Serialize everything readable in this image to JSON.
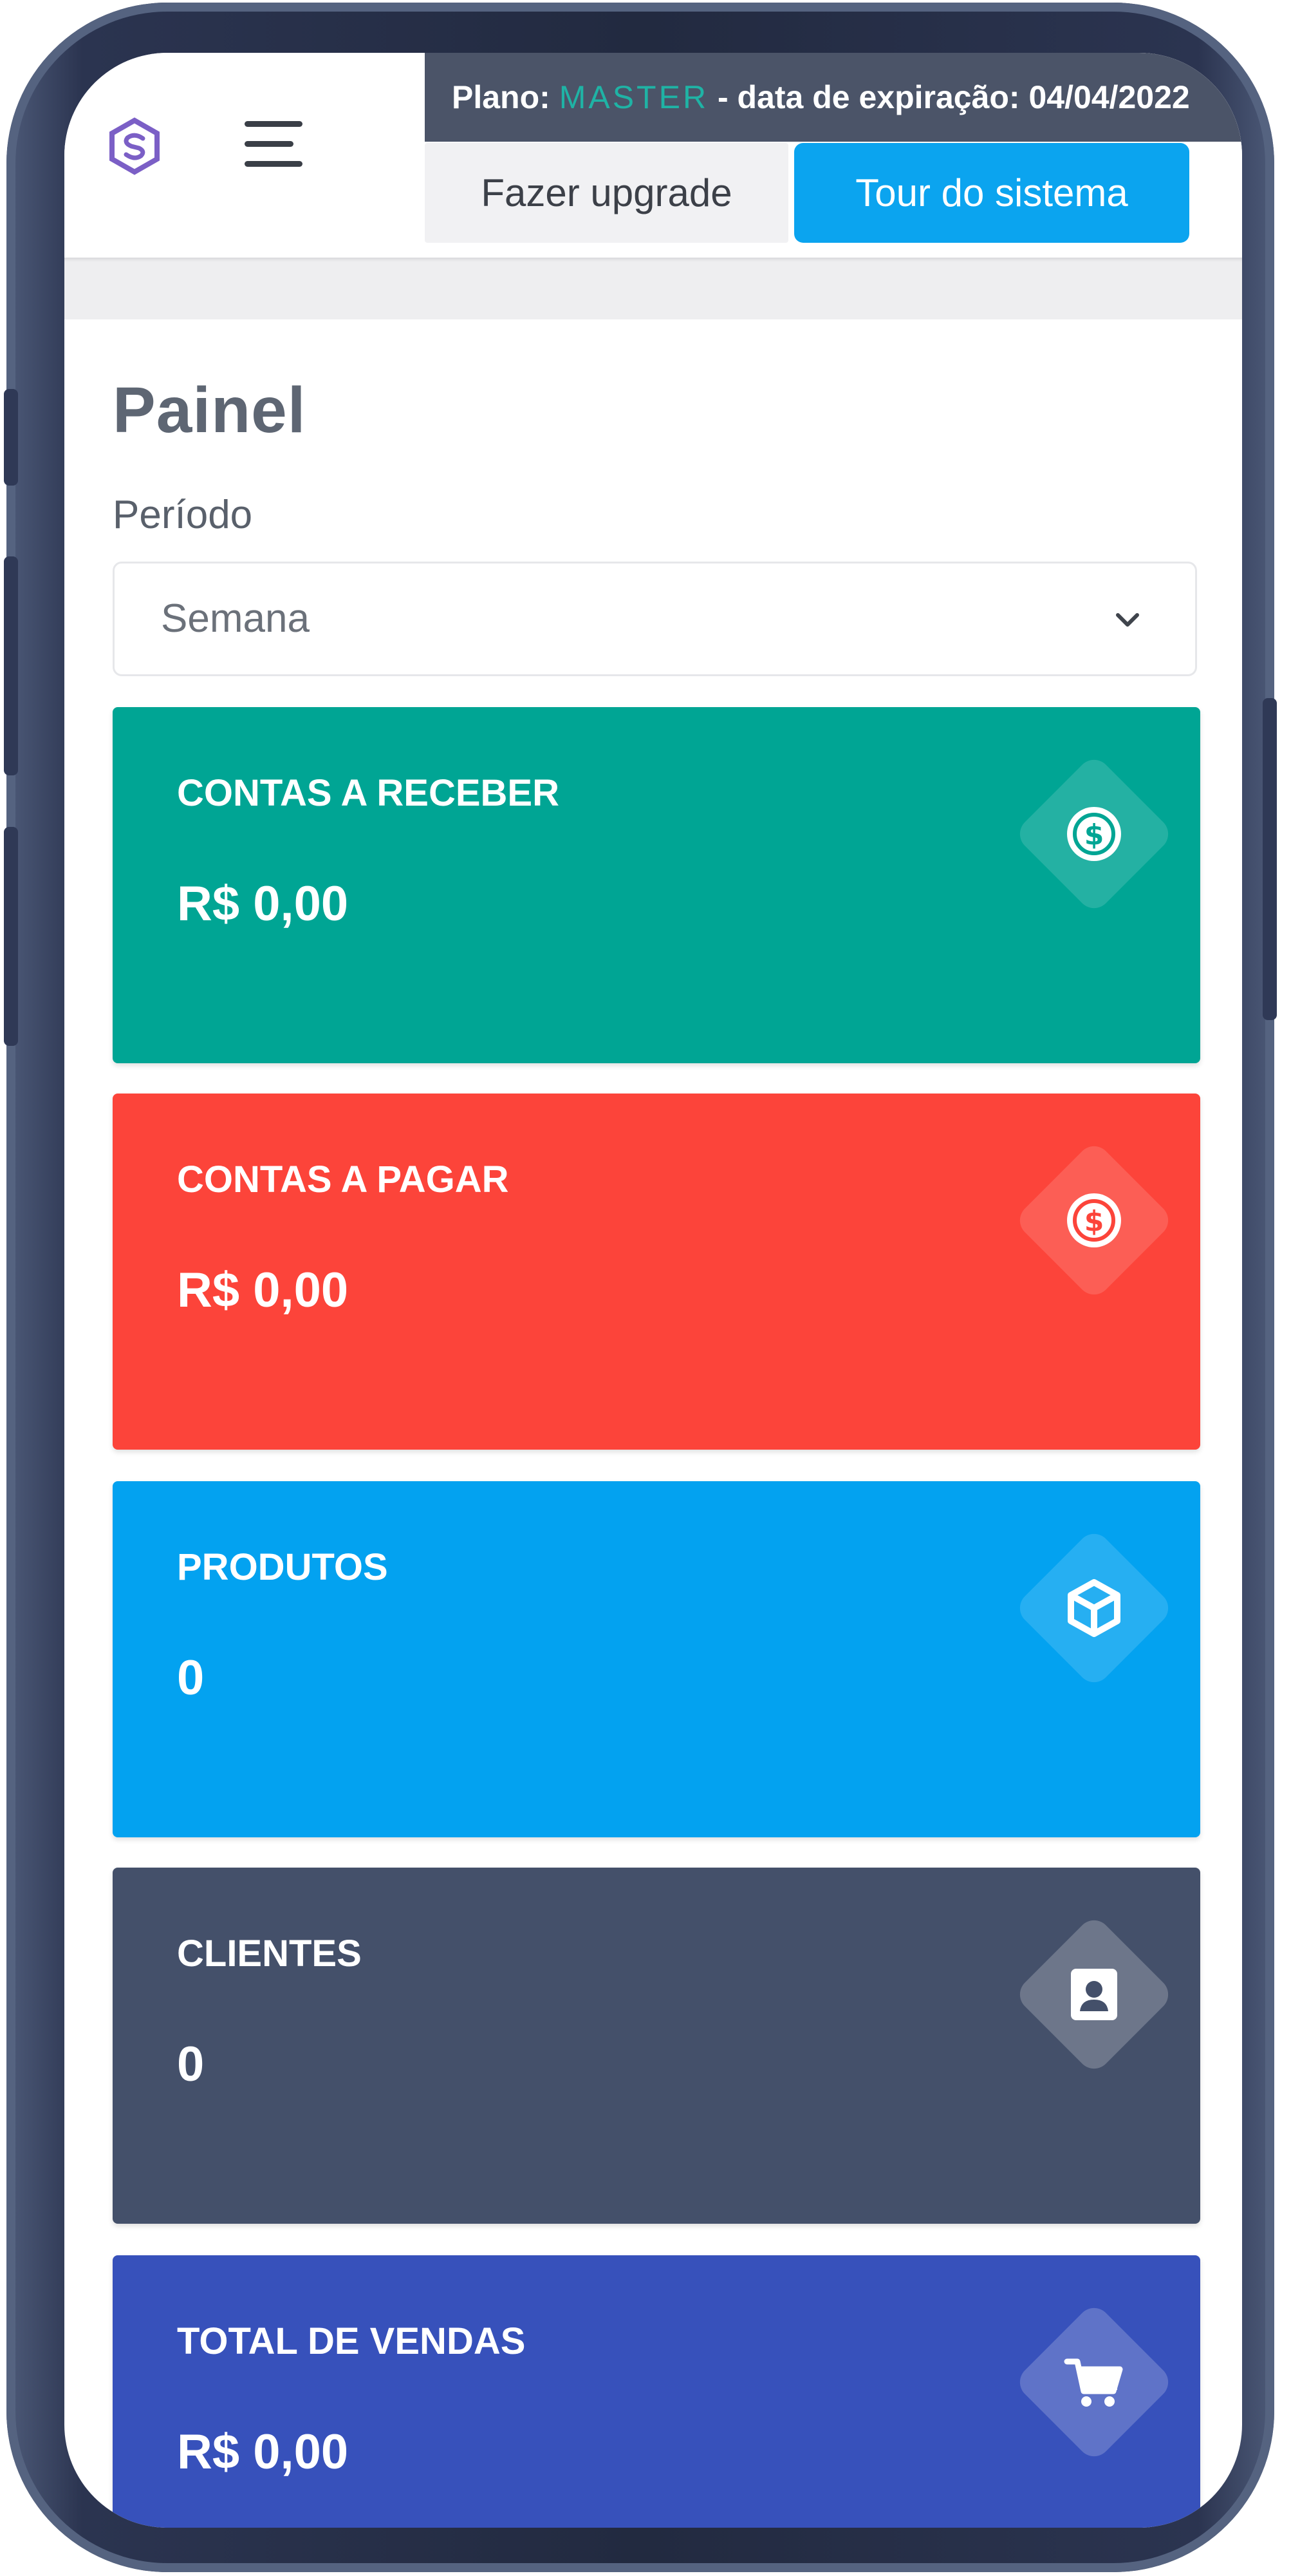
{
  "header": {
    "plan_prefix": "Plano:",
    "plan_name": "MASTER",
    "plan_suffix": "- data de expiração: 04/04/2022",
    "upgrade_label": "Fazer upgrade",
    "tour_label": "Tour do sistema"
  },
  "page": {
    "title": "Painel",
    "period_label": "Período",
    "period_value": "Semana"
  },
  "cards": [
    {
      "label": "CONTAS A RECEBER",
      "value": "R$ 0,00",
      "color": "#00a594",
      "icon": "dollar-coin-icon"
    },
    {
      "label": "CONTAS A PAGAR",
      "value": "R$ 0,00",
      "color": "#fc443a",
      "icon": "dollar-coin-icon"
    },
    {
      "label": "PRODUTOS",
      "value": "0",
      "color": "#03a2f0",
      "icon": "box-icon"
    },
    {
      "label": "CLIENTES",
      "value": "0",
      "color": "#44506a",
      "icon": "contact-card-icon"
    },
    {
      "label": "TOTAL DE VENDAS",
      "value": "R$ 0,00",
      "color": "#3751bb",
      "icon": "shopping-cart-icon"
    }
  ],
  "colors": {
    "plan_bar": "#4b5468",
    "accent_blue": "#0ba4ef",
    "master_text": "#1fb3a5"
  }
}
